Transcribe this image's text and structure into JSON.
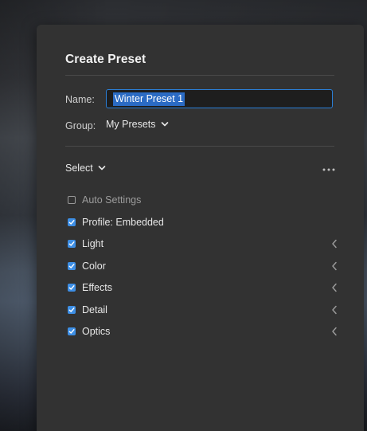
{
  "dialog": {
    "title": "Create Preset",
    "name_label": "Name:",
    "name_value": "Winter Preset 1",
    "group_label": "Group:",
    "group_value": "My Presets",
    "select_label": "Select",
    "more_icon": "more-dots-icon",
    "settings": [
      {
        "label": "Auto Settings",
        "checked": false,
        "expandable": false
      },
      {
        "label": "Profile: Embedded",
        "checked": true,
        "expandable": false
      },
      {
        "label": "Light",
        "checked": true,
        "expandable": true
      },
      {
        "label": "Color",
        "checked": true,
        "expandable": true
      },
      {
        "label": "Effects",
        "checked": true,
        "expandable": true
      },
      {
        "label": "Detail",
        "checked": true,
        "expandable": true
      },
      {
        "label": "Optics",
        "checked": true,
        "expandable": true
      }
    ]
  },
  "colors": {
    "dialog_bg": "#323232",
    "accent": "#3d8fe6",
    "focus_border": "#2a7fd8",
    "selection": "#2b6bc4"
  }
}
